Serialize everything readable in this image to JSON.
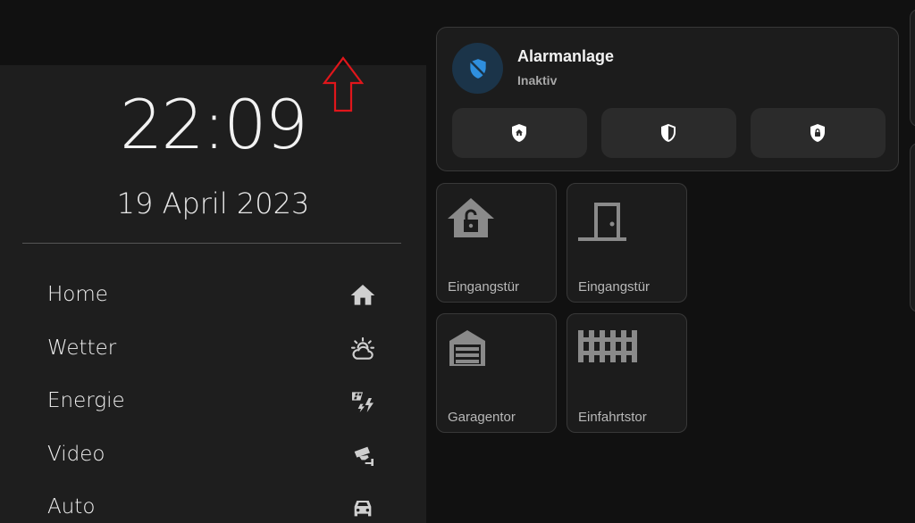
{
  "clock": {
    "time": "22:09",
    "date": "19 April 2023"
  },
  "nav": {
    "items": [
      {
        "label": "Home",
        "icon": "home-icon"
      },
      {
        "label": "Wetter",
        "icon": "weather-partly-cloudy-icon"
      },
      {
        "label": "Energie",
        "icon": "solar-power-icon"
      },
      {
        "label": "Video",
        "icon": "cctv-icon"
      },
      {
        "label": "Auto",
        "icon": "car-icon"
      }
    ]
  },
  "alarm": {
    "title": "Alarmanlage",
    "state": "Inaktiv",
    "badge_icon": "shield-off-icon",
    "buttons": [
      {
        "icon": "shield-home-icon"
      },
      {
        "icon": "shield-half-icon"
      },
      {
        "icon": "shield-lock-icon"
      }
    ]
  },
  "tiles": [
    {
      "label": "Eingangstür",
      "icon": "home-lock-open-icon"
    },
    {
      "label": "Eingangstür",
      "icon": "door-icon"
    },
    {
      "label": "Garagentor",
      "icon": "garage-icon"
    },
    {
      "label": "Einfahrtstor",
      "icon": "gate-icon"
    }
  ],
  "colors": {
    "background": "#111111",
    "sidebar": "#1e1e1e",
    "card": "#1c1c1c",
    "card_border": "#383838",
    "accent_blue": "#2f8fde",
    "icon_gray": "#8a8a8a",
    "annotation_red": "#e0161b"
  }
}
